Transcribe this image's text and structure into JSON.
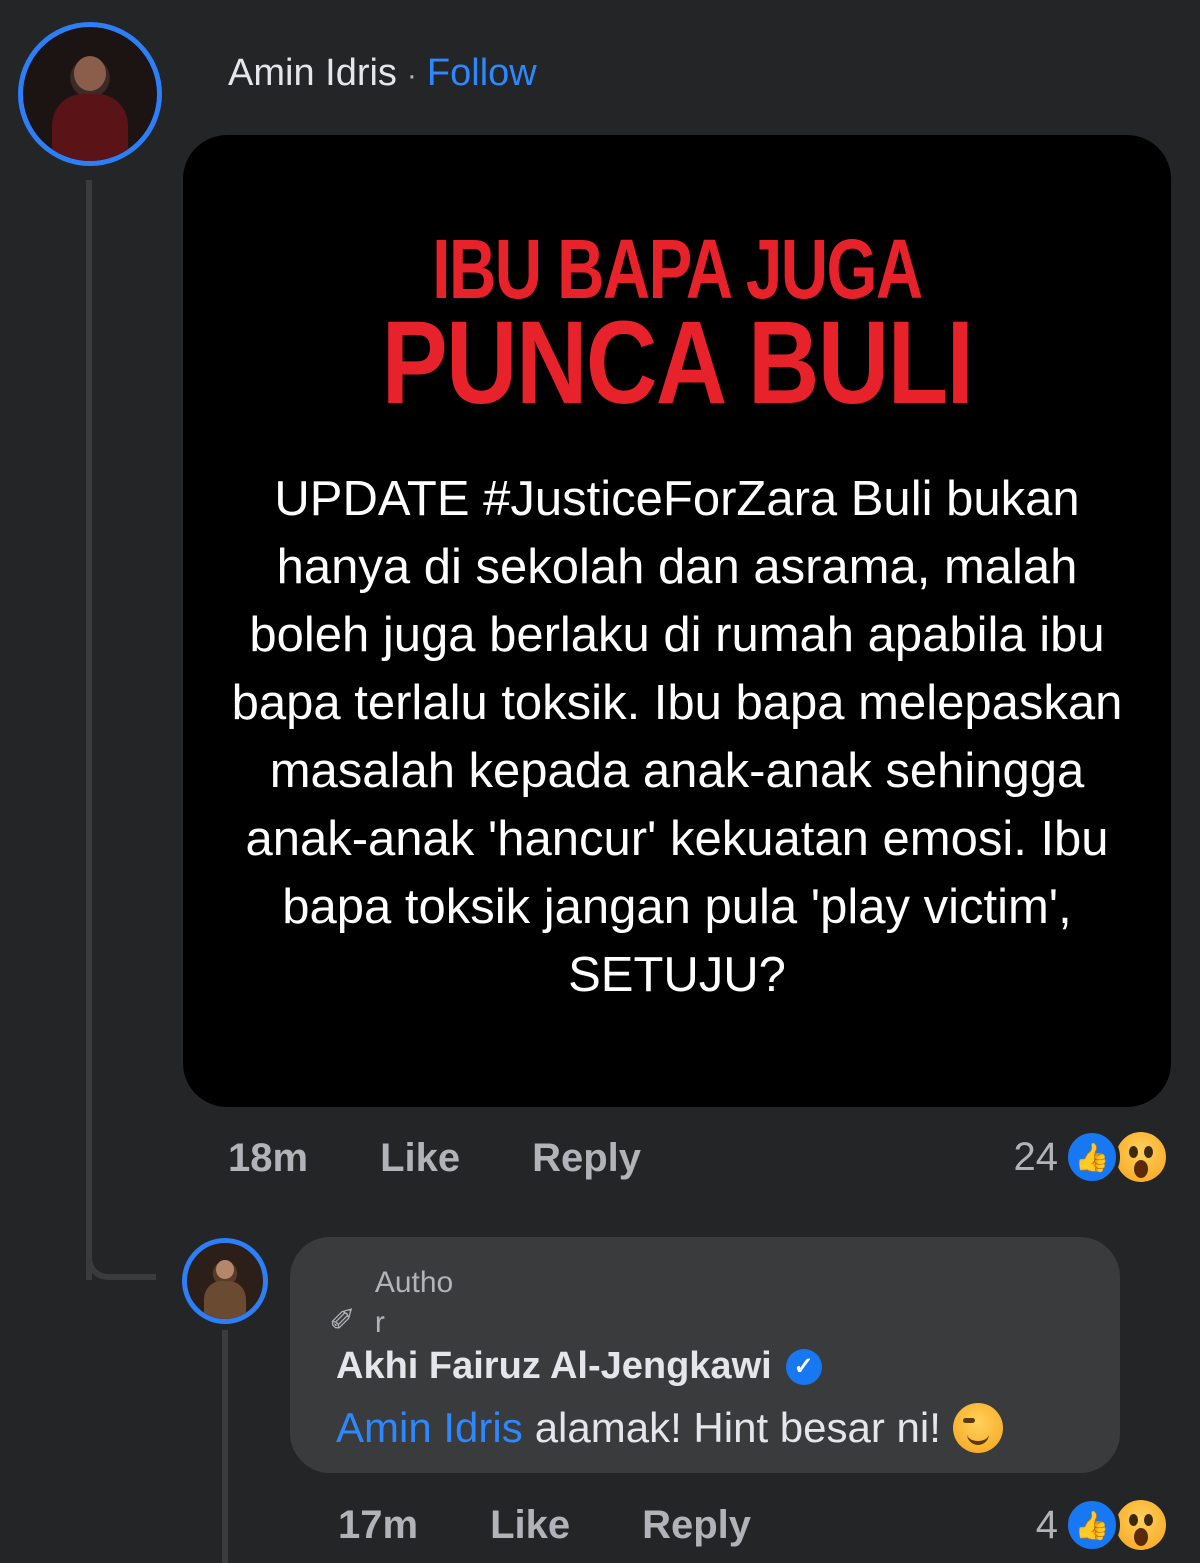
{
  "comment": {
    "author": "Amin Idris",
    "separator": "·",
    "follow_label": "Follow",
    "post": {
      "headline_line1": "IBU BAPA JUGA",
      "headline_line2": "PUNCA BULI",
      "body": "UPDATE #JusticeForZara Buli bukan hanya di sekolah dan asrama, malah boleh juga berlaku di rumah apabila ibu bapa terlalu toksik. Ibu bapa melepaskan masalah kepada anak-anak sehingga anak-anak 'hancur' kekuatan emosi. Ibu bapa toksik jangan pula 'play victim', SETUJU?"
    },
    "time": "18m",
    "like_label": "Like",
    "reply_label": "Reply",
    "reaction_count": "24",
    "reactions": [
      "like-icon",
      "wow-icon"
    ]
  },
  "reply": {
    "badge_line1": "Autho",
    "badge_line2": "r",
    "badge_icon": "pencil-icon",
    "author": "Akhi Fairuz Al-Jengkawi",
    "verified_icon": "verified-icon",
    "mention": "Amin Idris",
    "text": "alamak! Hint besar ni!",
    "emoji": "smirk-emoji-icon",
    "time": "17m",
    "like_label": "Like",
    "reply_label": "Reply",
    "reaction_count": "4",
    "reactions": [
      "like-icon",
      "wow-icon"
    ]
  },
  "colors": {
    "background": "#242526",
    "link": "#2d88ff",
    "headline": "#e8222a",
    "bubble": "#3a3b3c"
  }
}
